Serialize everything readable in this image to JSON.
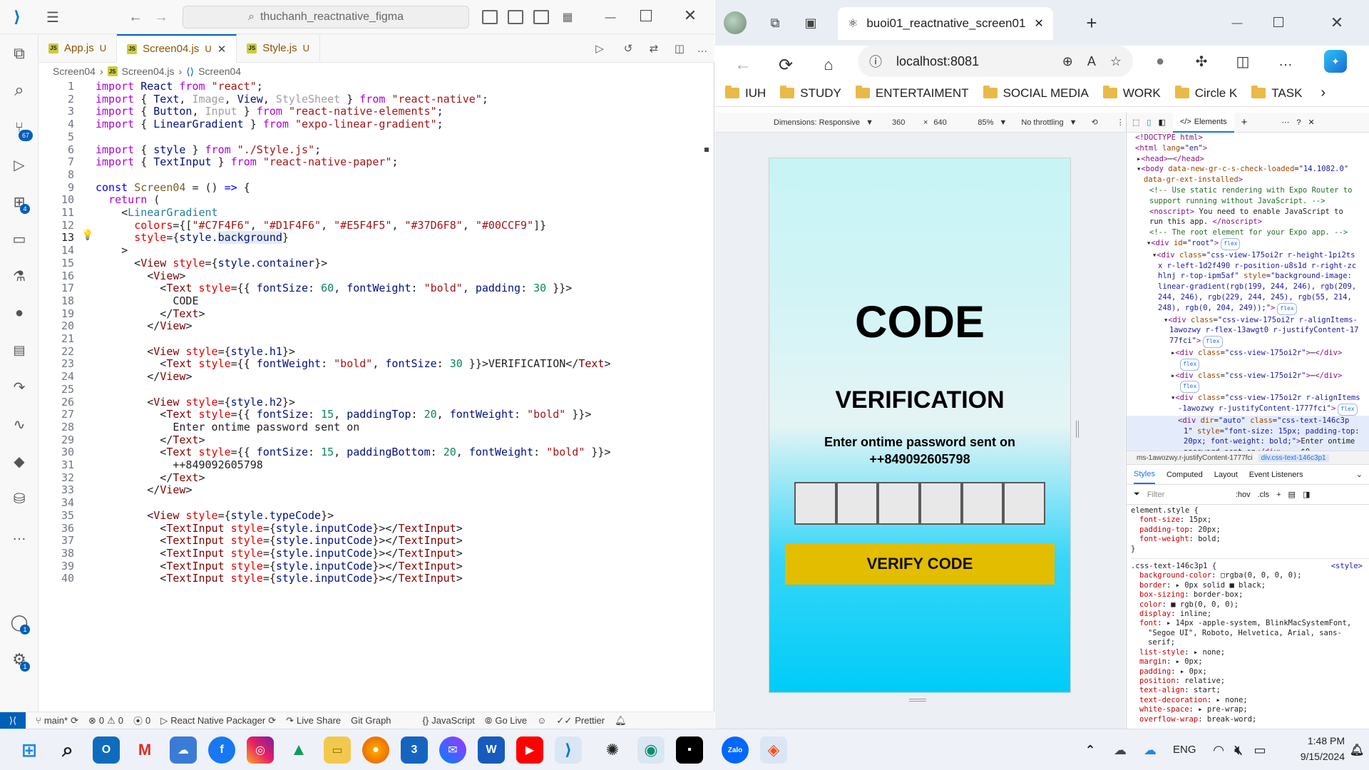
{
  "vscode": {
    "search_text": "thuchanh_reactnative_figma",
    "tabs": [
      {
        "label": "App.js",
        "status": "U"
      },
      {
        "label": "Screen04.js",
        "status": "U"
      },
      {
        "label": "Style.js",
        "status": "U"
      }
    ],
    "breadcrumb": [
      "Screen04",
      "Screen04.js",
      "Screen04"
    ],
    "badges": {
      "source_control": "67",
      "extensions": "4",
      "accounts": "1",
      "settings": "1"
    },
    "line_numbers": [
      "1",
      "2",
      "3",
      "4",
      "5",
      "6",
      "7",
      "8",
      "9",
      "10",
      "11",
      "12",
      "13",
      "14",
      "15",
      "16",
      "17",
      "18",
      "19",
      "20",
      "21",
      "22",
      "23",
      "24",
      "25",
      "26",
      "27",
      "28",
      "29",
      "30",
      "31",
      "32",
      "33",
      "34",
      "35",
      "36",
      "37",
      "38",
      "39",
      "40"
    ],
    "code": {
      "l18": "CODE",
      "l28": "Enter ontime password sent on",
      "l31": "++849092605798"
    },
    "status": {
      "branch": "main*",
      "errors": "0",
      "warnings": "0",
      "ports": "0",
      "packager": "React Native Packager",
      "live_share": "Live Share",
      "git_graph": "Git Graph",
      "language": "JavaScript",
      "go_live": "Go Live",
      "prettier": "Prettier"
    }
  },
  "edge": {
    "tab_title": "buoi01_reactnative_screen01",
    "url": "localhost:8081",
    "favorites": [
      "IUH",
      "STUDY",
      "ENTERTAIMENT",
      "SOCIAL MEDIA",
      "WORK",
      "Circle K",
      "TASK"
    ],
    "device_toolbar": {
      "dimensions": "Dimensions: Responsive",
      "width": "360",
      "height": "640",
      "zoom": "85%",
      "throttling": "No throttling"
    },
    "app": {
      "title": "CODE",
      "subtitle": "VERIFICATION",
      "line1": "Enter ontime password sent on",
      "line2": "++849092605798",
      "button": "VERIFY CODE"
    },
    "devtools": {
      "tab": "Elements",
      "crumb_left": "ms-1awozwy.r-justifyContent-1777fci",
      "crumb_right": "div.css-text-146c3p1",
      "subtabs": [
        "Styles",
        "Computed",
        "Layout",
        "Event Listeners"
      ],
      "filter_placeholder": "Filter",
      "hov": ":hov",
      "cls": ".cls"
    }
  },
  "taskbar": {
    "lang": "ENG",
    "time": "1:48 PM",
    "date": "9/15/2024"
  },
  "colors": {
    "accent": "#005fb8",
    "verify_button": "#e3bd00",
    "gradient": [
      "#C7F4F6",
      "#D1F4F6",
      "#E5F4F5",
      "#37D6F8",
      "#00CCF9"
    ]
  }
}
